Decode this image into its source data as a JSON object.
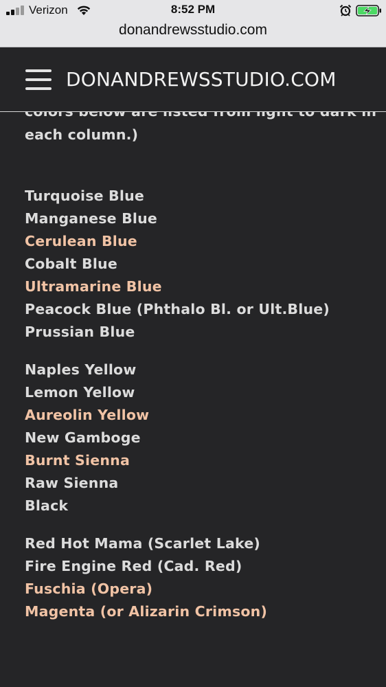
{
  "status_bar": {
    "carrier": "Verizon",
    "time": "8:52 PM"
  },
  "browser": {
    "url": "donandrewsstudio.com"
  },
  "header": {
    "site_title": "DONANDREWSSTUDIO.COM"
  },
  "intro": {
    "line_clipped": "colors below are listed from light to dark in",
    "line_2": "each column.)"
  },
  "colors": {
    "accent": "#f1c3a5",
    "text": "#dcdcdc",
    "background": "#252527"
  },
  "color_groups": [
    {
      "items": [
        {
          "label": "Turquoise Blue",
          "highlight": false
        },
        {
          "label": "Manganese Blue",
          "highlight": false
        },
        {
          "label": "Cerulean Blue",
          "highlight": true
        },
        {
          "label": "Cobalt Blue",
          "highlight": false
        },
        {
          "label": "Ultramarine Blue",
          "highlight": true
        },
        {
          "label": "Peacock Blue (Phthalo Bl. or Ult.Blue)",
          "highlight": false
        },
        {
          "label": "Prussian Blue",
          "highlight": false
        }
      ]
    },
    {
      "items": [
        {
          "label": "Naples Yellow",
          "highlight": false
        },
        {
          "label": "Lemon Yellow",
          "highlight": false
        },
        {
          "label": "Aureolin Yellow",
          "highlight": true
        },
        {
          "label": "New Gamboge",
          "highlight": false
        },
        {
          "label": "Burnt Sienna",
          "highlight": true
        },
        {
          "label": "Raw Sienna",
          "highlight": false
        },
        {
          "label": "Black",
          "highlight": false
        }
      ]
    },
    {
      "items": [
        {
          "label": "Red Hot Mama (Scarlet Lake)",
          "highlight": false
        },
        {
          "label": "Fire Engine Red (Cad. Red)",
          "highlight": false
        },
        {
          "label": "Fuschia (Opera)",
          "highlight": true
        },
        {
          "label": "Magenta (or Alizarin Crimson)",
          "highlight": true
        }
      ]
    }
  ]
}
